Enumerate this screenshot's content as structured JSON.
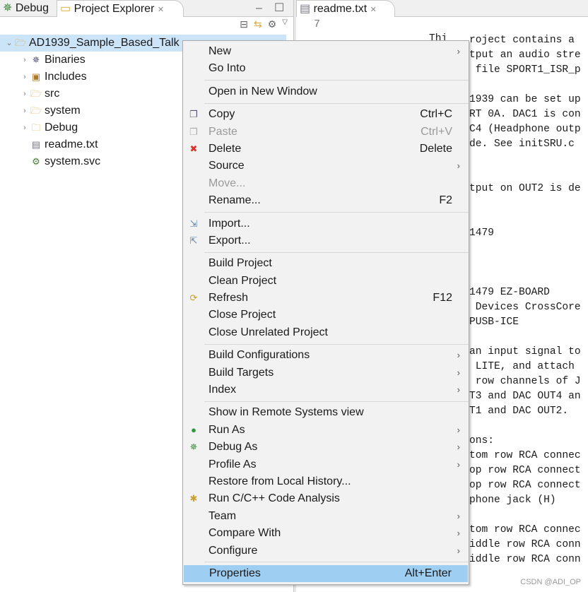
{
  "left_pane": {
    "tabs": [
      {
        "label": "Debug",
        "icon": "debug-bug-icon"
      },
      {
        "label": "Project Explorer",
        "icon": "folder-icon",
        "active": true
      }
    ],
    "tree": [
      {
        "label": "AD1939_Sample_Based_Talk",
        "expanded": true,
        "selected": true,
        "icon": "project-folder-icon",
        "level": 0
      },
      {
        "label": "Binaries",
        "icon": "binaries-icon",
        "level": 1
      },
      {
        "label": "Includes",
        "icon": "includes-icon",
        "level": 1
      },
      {
        "label": "src",
        "icon": "source-folder-icon",
        "level": 1
      },
      {
        "label": "system",
        "icon": "system-folder-icon",
        "level": 1
      },
      {
        "label": "Debug",
        "icon": "folder-icon",
        "level": 1
      },
      {
        "label": "readme.txt",
        "icon": "text-file-icon",
        "level": 1,
        "leaf": true
      },
      {
        "label": "system.svc",
        "icon": "svc-file-icon",
        "level": 1,
        "leaf": true
      }
    ]
  },
  "editor": {
    "tab": "readme.txt",
    "line_number": "7",
    "fragment": "Thi",
    "lines": [
      "roject contains a",
      "tput an audio stre",
      " file SPORT1_ISR_p",
      "",
      "1939 can be set up",
      "RT 0A. DAC1 is con",
      "C4 (Headphone outp",
      "de. See initSRU.c",
      "",
      "",
      "tput on OUT2 is de",
      "",
      "",
      "1479",
      "",
      "",
      "",
      "1479 EZ-BOARD",
      " Devices CrossCore",
      "PUSB-ICE",
      "",
      "an input signal to",
      " LITE, and attach",
      " row channels of J",
      "T3 and DAC OUT4 an",
      "T1 and DAC OUT2.",
      "",
      "ons:",
      "tom row RCA connec",
      "op row RCA connect",
      "op row RCA connect",
      "phone jack (H)",
      "",
      "tom row RCA connec",
      "iddle row RCA conn",
      "iddle row RCA conn"
    ]
  },
  "context_menu": [
    {
      "label": "New",
      "submenu": true
    },
    {
      "label": "Go Into"
    },
    {
      "sep": true
    },
    {
      "label": "Open in New Window"
    },
    {
      "sep": true
    },
    {
      "label": "Copy",
      "shortcut": "Ctrl+C",
      "icon": "copy-icon"
    },
    {
      "label": "Paste",
      "shortcut": "Ctrl+V",
      "icon": "paste-icon",
      "disabled": true
    },
    {
      "label": "Delete",
      "shortcut": "Delete",
      "icon": "delete-icon"
    },
    {
      "label": "Source",
      "submenu": true
    },
    {
      "label": "Move...",
      "disabled": true
    },
    {
      "label": "Rename...",
      "shortcut": "F2"
    },
    {
      "sep": true
    },
    {
      "label": "Import...",
      "icon": "import-icon"
    },
    {
      "label": "Export...",
      "icon": "export-icon"
    },
    {
      "sep": true
    },
    {
      "label": "Build Project"
    },
    {
      "label": "Clean Project"
    },
    {
      "label": "Refresh",
      "shortcut": "F12",
      "icon": "refresh-icon"
    },
    {
      "label": "Close Project"
    },
    {
      "label": "Close Unrelated Project"
    },
    {
      "sep": true
    },
    {
      "label": "Build Configurations",
      "submenu": true
    },
    {
      "label": "Build Targets",
      "submenu": true
    },
    {
      "label": "Index",
      "submenu": true
    },
    {
      "sep": true
    },
    {
      "label": "Show in Remote Systems view"
    },
    {
      "label": "Run As",
      "submenu": true,
      "icon": "run-icon"
    },
    {
      "label": "Debug As",
      "submenu": true,
      "icon": "debug-bug-icon"
    },
    {
      "label": "Profile As",
      "submenu": true
    },
    {
      "label": "Restore from Local History..."
    },
    {
      "label": "Run C/C++ Code Analysis",
      "icon": "code-analysis-icon"
    },
    {
      "label": "Team",
      "submenu": true
    },
    {
      "label": "Compare With",
      "submenu": true
    },
    {
      "label": "Configure",
      "submenu": true
    },
    {
      "sep": true
    },
    {
      "label": "Properties",
      "shortcut": "Alt+Enter",
      "highlighted": true
    }
  ],
  "watermark": "CSDN @ADI_OP",
  "colors": {
    "selection": "#cce4f7",
    "menu_highlight": "#9fcef3",
    "delete_icon": "#d9342b",
    "run_icon": "#2a9a3a"
  }
}
